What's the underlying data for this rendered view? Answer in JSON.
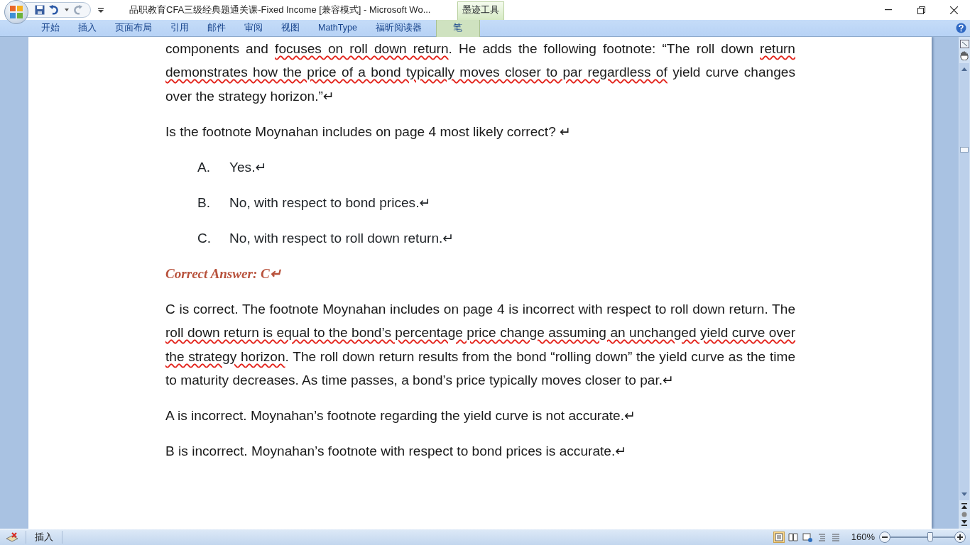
{
  "window": {
    "title": "品职教育CFA三级经典题通关课-Fixed Income [兼容模式] - Microsoft Wo...",
    "context_tab_group": "墨迹工具"
  },
  "ribbon_tabs": [
    {
      "label": "开始",
      "context": false
    },
    {
      "label": "插入",
      "context": false
    },
    {
      "label": "页面布局",
      "context": false
    },
    {
      "label": "引用",
      "context": false
    },
    {
      "label": "邮件",
      "context": false
    },
    {
      "label": "审阅",
      "context": false
    },
    {
      "label": "视图",
      "context": false
    },
    {
      "label": "MathType",
      "context": false
    },
    {
      "label": "福昕阅读器",
      "context": false
    },
    {
      "label": "笔",
      "context": true
    }
  ],
  "document": {
    "paragraphs": [
      {
        "kind": "body",
        "segments": [
          {
            "text": "components and ",
            "ink": false
          },
          {
            "text": "focuses on roll down return",
            "ink": true
          },
          {
            "text": ". He adds the following footnote: “The roll down ",
            "ink": false
          },
          {
            "text": "return demonstrates how the price of a bond typically moves closer to par regardless of",
            "ink": true
          },
          {
            "text": " yield curve changes over the strategy horizon.”↵",
            "ink": false
          }
        ]
      },
      {
        "kind": "body",
        "segments": [
          {
            "text": "Is the footnote Moynahan includes on page 4 most likely correct?  ↵",
            "ink": false
          }
        ]
      },
      {
        "kind": "option",
        "letter": "A.",
        "segments": [
          {
            "text": "Yes.↵",
            "ink": false
          }
        ]
      },
      {
        "kind": "option",
        "letter": "B.",
        "segments": [
          {
            "text": "No, with respect to bond prices.↵",
            "ink": false
          }
        ]
      },
      {
        "kind": "option",
        "letter": "C.",
        "segments": [
          {
            "text": "No, with respect to roll down return.↵",
            "ink": false
          }
        ]
      },
      {
        "kind": "answer",
        "segments": [
          {
            "text": "Correct Answer: C↵",
            "ink": false
          }
        ]
      },
      {
        "kind": "body",
        "segments": [
          {
            "text": "C is correct. The footnote Moynahan includes on page 4 is incorrect with respect to roll down return. The ",
            "ink": false
          },
          {
            "text": "roll down return is equal to the bond’s percentage price change assuming an unchanged yield curve over the strategy horizon",
            "ink": true
          },
          {
            "text": ". The roll down return results from the bond “rolling down” the yield curve as the time to maturity decreases. As time passes, a bond’s price typically moves closer to par.↵",
            "ink": false
          }
        ]
      },
      {
        "kind": "body",
        "segments": [
          {
            "text": "A is incorrect. Moynahan’s footnote regarding the yield curve is not accurate.↵",
            "ink": false
          }
        ]
      },
      {
        "kind": "body",
        "segments": [
          {
            "text": "B is incorrect. Moynahan’s footnote with respect to bond prices is accurate.↵",
            "ink": false
          }
        ]
      }
    ]
  },
  "status_bar": {
    "mode": "插入",
    "views": [
      {
        "selected": true
      },
      {
        "selected": false
      },
      {
        "selected": false
      },
      {
        "selected": false
      },
      {
        "selected": false
      }
    ],
    "zoom": "160%",
    "zoom_slider": {
      "level": 0.62
    }
  }
}
